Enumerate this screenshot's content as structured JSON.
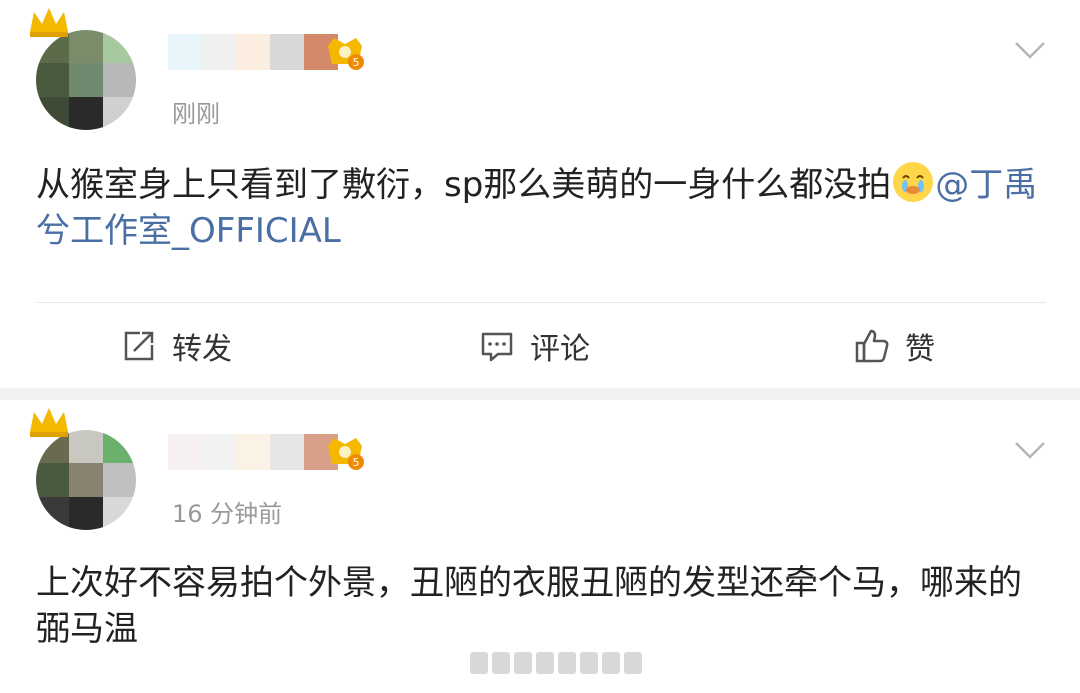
{
  "posts": [
    {
      "time": "刚刚",
      "content_text": "从猴室身上只看到了敷衍，sp那么美萌的一身什么都没拍",
      "mention": "@丁禹兮工作室_OFFICIAL",
      "actions": {
        "repost": "转发",
        "comment": "评论",
        "like": "赞"
      }
    },
    {
      "time": "16 分钟前",
      "content_text": "上次好不容易拍个外景，丑陋的衣服丑陋的发型还牵个马，哪来的弼马温"
    }
  ],
  "icons": {
    "crown": "crown-icon",
    "vip": "vip-level-badge-icon",
    "chevron": "chevron-down-icon",
    "repost": "repost-icon",
    "comment": "comment-icon",
    "like": "thumbs-up-icon",
    "emoji": "crying-face-emoji"
  },
  "colors": {
    "mention": "#4a6fa5",
    "time": "#999999",
    "text": "#222222",
    "crown": "#f5b800"
  }
}
